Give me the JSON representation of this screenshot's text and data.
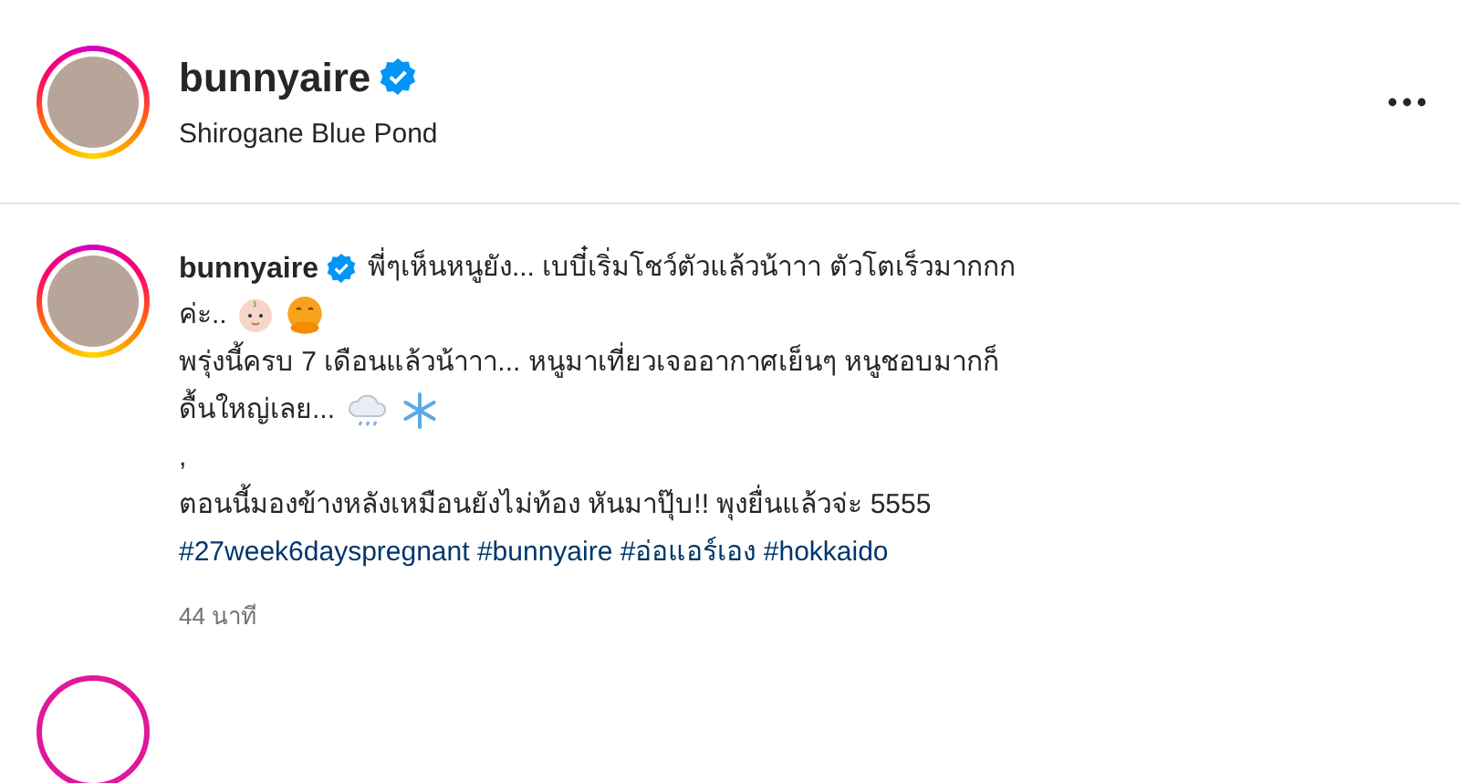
{
  "header": {
    "username": "bunnyaire",
    "verified": true,
    "location": "Shirogane Blue Pond"
  },
  "post": {
    "username": "bunnyaire",
    "verified": true,
    "paragraphs": [
      {
        "lines": [
          "พี่ๆเห็นหนูยัง... เบบี๋เริ่มโชว์ตัวแล้วน้าาา ตัวโตเร็วมากกก",
          "ค่ะ.."
        ]
      },
      {
        "lines": [
          "พรุ่งนี้ครบ 7 เดือนแล้วน้าาา... หนูมาเที่ยวเจออากาศเย็นๆ หนูชอบมากก็",
          "ดื้นใหญ่เลย..."
        ]
      },
      {
        "lines": [
          ","
        ]
      },
      {
        "lines": [
          "ตอนนี้มองข้างหลังเหมือนยังไม่ท้อง หันมาปุ๊บ!! พุงยื่นแล้วจ่ะ 5555"
        ]
      }
    ],
    "hashtags": [
      "#27week6dayspregnant",
      "#bunnyaire",
      "#อ่อแอร์เอง",
      "#hokkaido"
    ],
    "time": "44 นาที"
  }
}
